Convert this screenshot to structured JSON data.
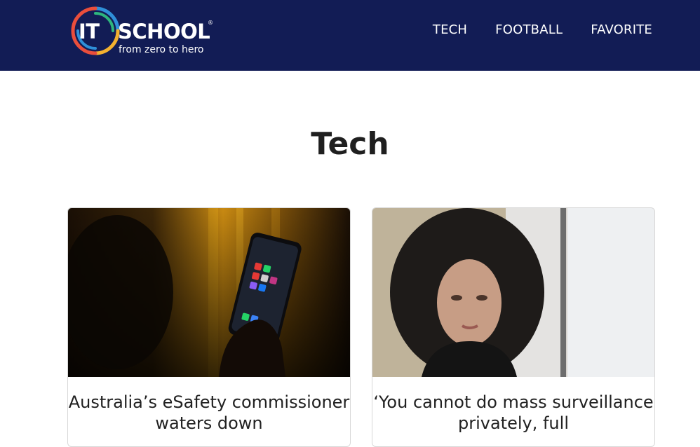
{
  "brand": {
    "logo_it": "IT",
    "logo_school": "SCHOOL",
    "logo_registered": "®",
    "tagline": "from zero to hero"
  },
  "nav": {
    "items": [
      {
        "label": "TECH"
      },
      {
        "label": "FOOTBALL"
      },
      {
        "label": "FAVORITE"
      }
    ]
  },
  "page": {
    "title": "Tech"
  },
  "articles": [
    {
      "title": "Australia’s eSafety commissioner waters down",
      "image": "phone-social-apps-image"
    },
    {
      "title": "‘You cannot do mass surveillance privately, full",
      "image": "portrait-woman-image"
    }
  ],
  "colors": {
    "navbar_bg": "#121c55",
    "logo_ring": [
      "#e94e3c",
      "#f3b12f",
      "#2eb67d",
      "#2f8fd8"
    ]
  }
}
